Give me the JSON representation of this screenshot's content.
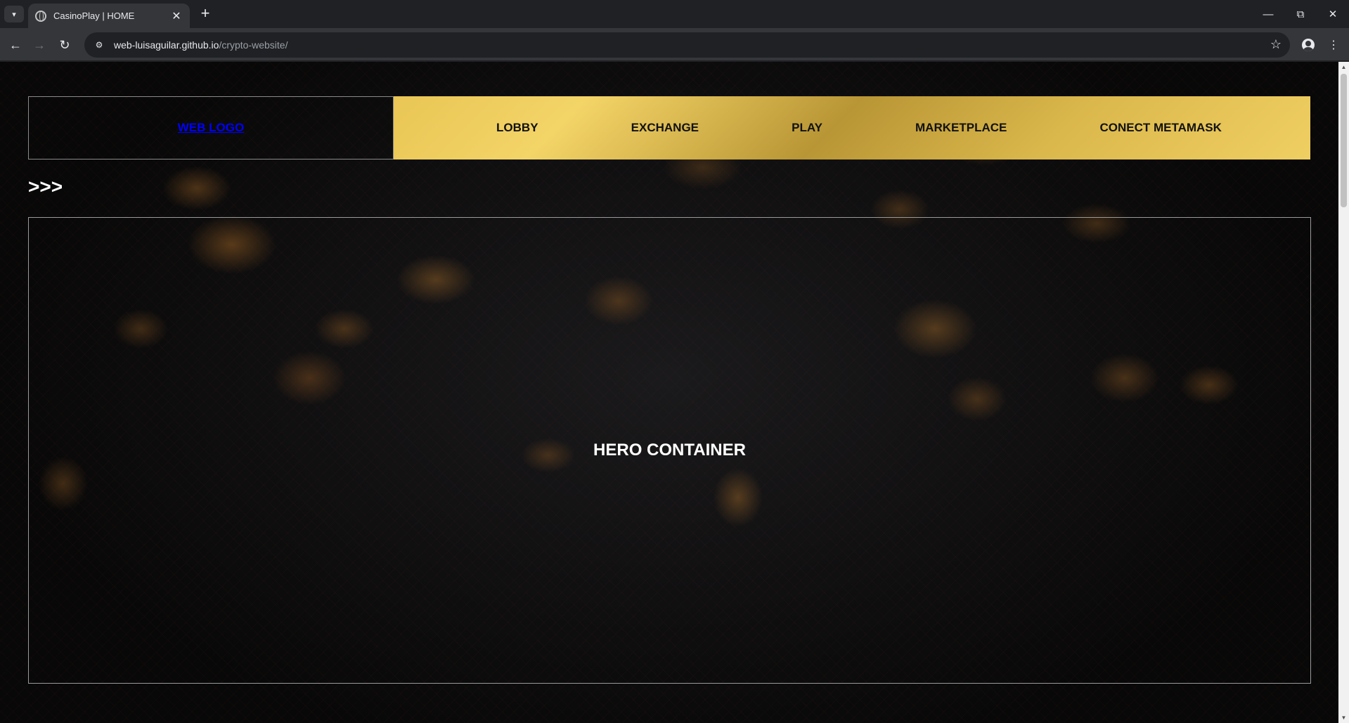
{
  "browser": {
    "tab_title": "CasinoPlay | HOME",
    "url_host": "web-luisaguilar.github.io",
    "url_path": "/crypto-website/"
  },
  "site": {
    "logo": "WEB LOGO",
    "nav": [
      "LOBBY",
      "EXCHANGE",
      "PLAY",
      "MARKETPLACE",
      "CONECT METAMASK"
    ],
    "arrows": ">>>",
    "hero_title": "HERO CONTAINER"
  },
  "colors": {
    "nav_gold": "#e9c655",
    "logo_link": "#0000ff",
    "page_bg": "#080808"
  },
  "icons": [
    "tab-search-icon",
    "globe-icon",
    "close-icon",
    "plus-icon",
    "minimize-icon",
    "restore-icon",
    "back-icon",
    "forward-icon",
    "reload-icon",
    "site-settings-icon",
    "star-icon",
    "profile-icon",
    "menu-dots-icon"
  ]
}
